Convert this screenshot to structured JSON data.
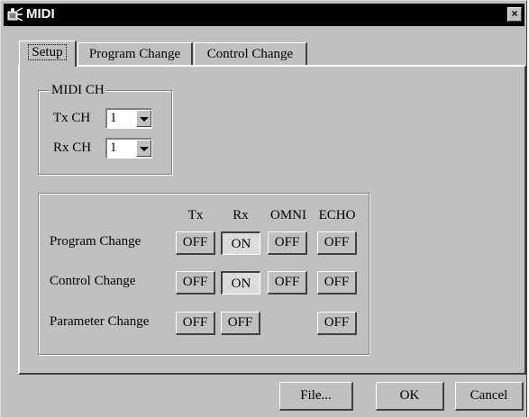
{
  "window": {
    "title": "MIDI",
    "close_label": "×"
  },
  "tabs": [
    "Setup",
    "Program Change",
    "Control Change"
  ],
  "midi_ch": {
    "legend": "MIDI CH",
    "tx_label": "Tx CH",
    "tx_value": "1",
    "rx_label": "Rx CH",
    "rx_value": "1"
  },
  "matrix": {
    "headers": [
      "Tx",
      "Rx",
      "OMNI",
      "ECHO"
    ],
    "rows": [
      {
        "label": "Program Change",
        "tx": "OFF",
        "rx": "ON",
        "omni": "OFF",
        "echo": "OFF"
      },
      {
        "label": "Control Change",
        "tx": "OFF",
        "rx": "ON",
        "omni": "OFF",
        "echo": "OFF"
      },
      {
        "label": "Parameter Change",
        "tx": "OFF",
        "rx": "OFF",
        "echo": "OFF"
      }
    ]
  },
  "buttons": {
    "file": "File...",
    "ok": "OK",
    "cancel": "Cancel"
  }
}
